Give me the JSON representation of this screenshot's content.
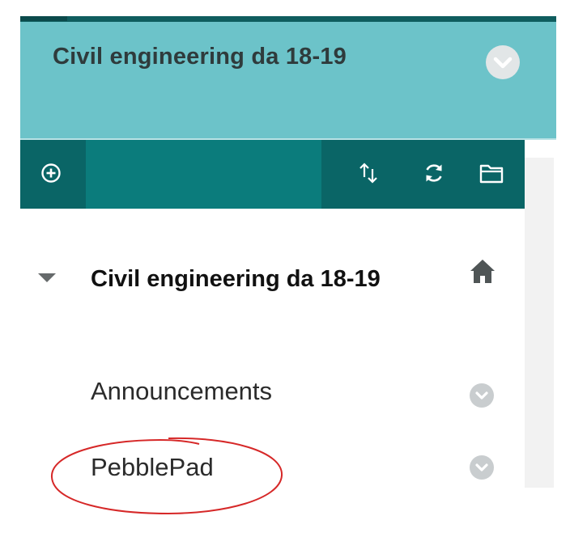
{
  "course": {
    "title": "Civil engineering da 18-19"
  },
  "toolbar": {
    "add_icon": "plus-circle-icon",
    "reorder_icon": "sort-arrows-icon",
    "refresh_icon": "refresh-icon",
    "folder_icon": "folder-icon"
  },
  "menu": {
    "heading": "Civil engineering da 18-19",
    "items": [
      {
        "label": "Announcements"
      },
      {
        "label": "PebblePad"
      }
    ]
  },
  "colors": {
    "header_bg": "#6cc3c9",
    "toolbar_bg": "#0b7c7c",
    "toolbar_dark": "#0a6566",
    "annotation": "#d62828"
  }
}
